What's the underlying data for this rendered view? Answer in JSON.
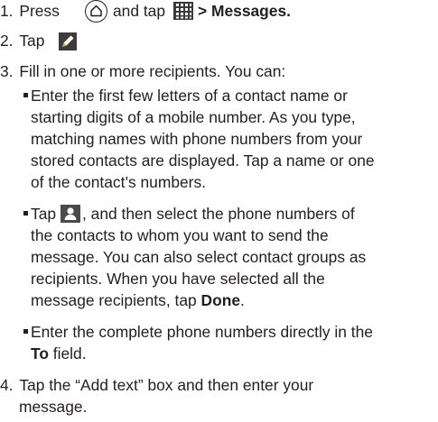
{
  "steps": [
    {
      "number": "1.",
      "text_a": "Press",
      "text_b": "and tap",
      "text_c": "> Messages."
    },
    {
      "number": "2.",
      "text_a": "Tap"
    },
    {
      "number": "3.",
      "text": "Fill in one or more recipients. You can:"
    },
    {
      "number": "4.",
      "lines": [
        "Tap the “Add text” box and then enter your",
        "message."
      ]
    }
  ],
  "bullets": [
    {
      "lines": [
        "Enter the first few letters of a contact name or",
        "starting digits of a mobile number. As you type,",
        "matching names with phone numbers from your",
        "stored contacts are displayed. Tap a name or one",
        "of the contact’s numbers."
      ]
    },
    {
      "line1_a": "Tap",
      "line1_b": ", and then select the phone numbers of",
      "lines": [
        "the contacts to whom you want to send the",
        "message. You can also select contact groups as",
        "recipients. When you have selected all the"
      ],
      "last_a": "message recipients, tap",
      "last_bold": "Done",
      "last_c": "."
    },
    {
      "line1": "Enter the complete phone numbers directly in the",
      "line2_bold": "To",
      "line2_rest": " field."
    }
  ],
  "icons": {
    "home": "home-icon",
    "apps": "all-apps-grid-icon",
    "compose": "compose-pencil-icon",
    "contacts": "contacts-person-icon"
  }
}
